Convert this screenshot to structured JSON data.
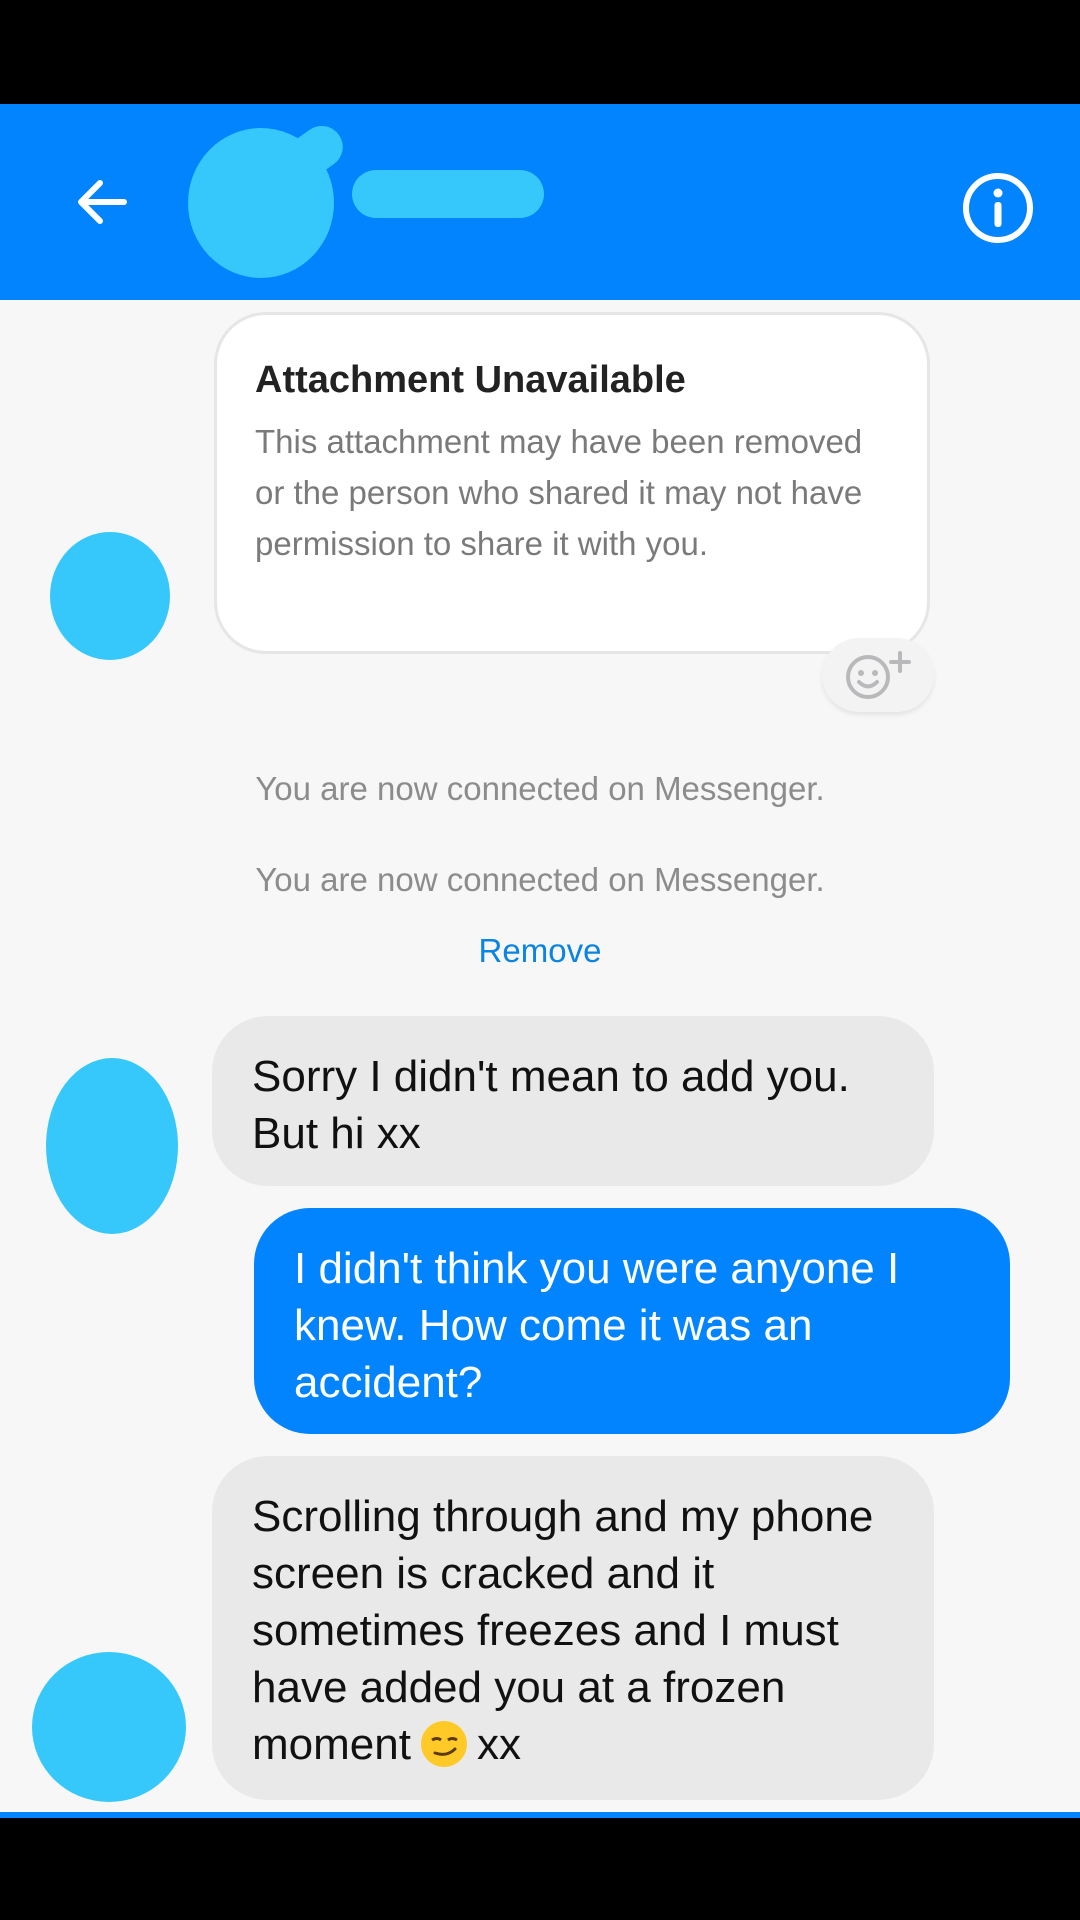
{
  "header": {
    "contact_name": "",
    "back_icon": "arrow-left-icon",
    "info_icon": "info-circle-icon"
  },
  "attachment_card": {
    "title": "Attachment Unavailable",
    "body": "This attachment may have been removed or the person who shared it may not have permission to share it with you.",
    "reaction_icon": "add-reaction-icon"
  },
  "system_messages": [
    "You are now connected on Messenger.",
    "You are now connected on Messenger."
  ],
  "remove_label": "Remove",
  "messages": [
    {
      "direction": "incoming",
      "text": "Sorry I didn't mean to add you. But hi xx"
    },
    {
      "direction": "outgoing",
      "text": "I didn't think you were anyone I knew. How come it was an accident?"
    },
    {
      "direction": "incoming",
      "text_before_emoji": "Scrolling through and my phone screen is cracked and it sometimes freezes and I must have added you at a frozen moment",
      "emoji": "smirking-face-emoji",
      "text_after_emoji": "xx"
    }
  ],
  "colors": {
    "brand_blue": "#0384ff",
    "redaction_blue": "#37c8fb",
    "incoming_bubble": "#e9e9ea",
    "background": "#f7f7f8",
    "link_blue": "#0a84e0"
  }
}
